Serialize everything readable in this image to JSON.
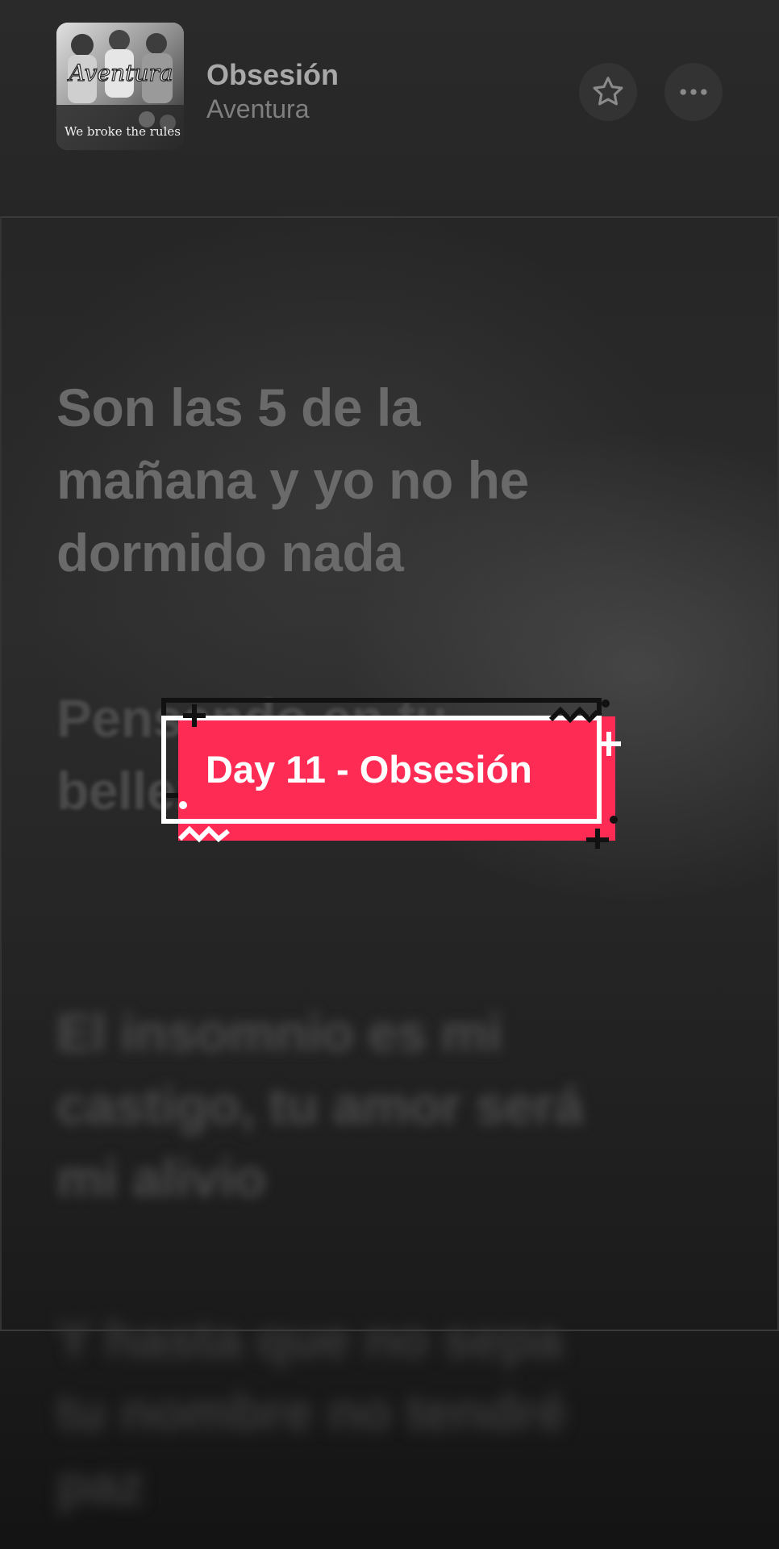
{
  "header": {
    "title": "Obsesión",
    "artist": "Aventura",
    "album_art": {
      "logo_text": "Aventura",
      "caption": "We broke the rules"
    }
  },
  "lyrics": [
    "Son las 5 de la mañana y yo no he dormido nada",
    "Pensando en tu belleza voy a parar",
    "El insomnio es mi castigo, tu amor será mi alivio",
    "Y hasta que no sepa tu nombre no tendré paz"
  ],
  "sticker": {
    "label": "Day 11 - Obsesión",
    "color": "#fe2c55"
  },
  "icons": {
    "favorite": "star-icon",
    "more": "more-horizontal-icon"
  }
}
